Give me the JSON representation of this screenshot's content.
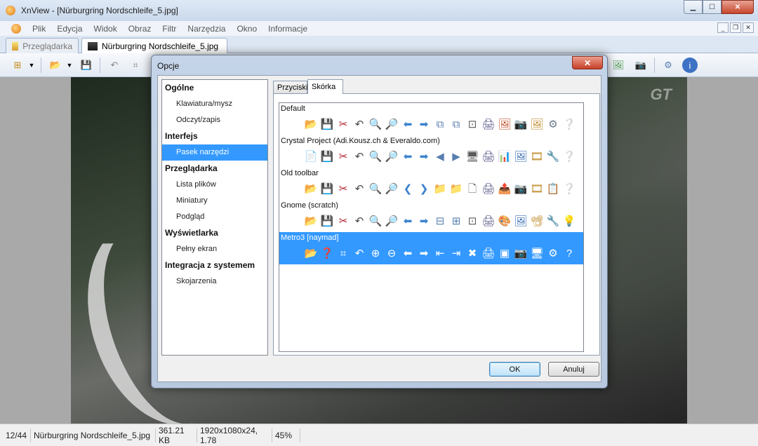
{
  "window": {
    "title": "XnView - [Nürburgring Nordschleife_5.jpg]"
  },
  "menu": [
    "Plik",
    "Edycja",
    "Widok",
    "Obraz",
    "Filtr",
    "Narzędzia",
    "Okno",
    "Informacje"
  ],
  "doc_tabs": [
    "Przeglądarka",
    "Nürburgring Nordschleife_5.jpg"
  ],
  "dialog": {
    "title": "Opcje",
    "close_label": "✕",
    "nav": [
      {
        "type": "head",
        "label": "Ogólne"
      },
      {
        "type": "item",
        "label": "Klawiatura/mysz"
      },
      {
        "type": "item",
        "label": "Odczyt/zapis"
      },
      {
        "type": "head",
        "label": "Interfejs"
      },
      {
        "type": "item",
        "label": "Pasek narzędzi",
        "selected": true
      },
      {
        "type": "head",
        "label": "Przeglądarka"
      },
      {
        "type": "item",
        "label": "Lista plików"
      },
      {
        "type": "item",
        "label": "Miniatury"
      },
      {
        "type": "item",
        "label": "Podgląd"
      },
      {
        "type": "head",
        "label": "Wyświetlarka"
      },
      {
        "type": "item",
        "label": "Pełny ekran"
      },
      {
        "type": "head",
        "label": "Integracja z systemem"
      },
      {
        "type": "item",
        "label": "Skojarzenia"
      }
    ],
    "tabs": {
      "buttons": "Przyciski",
      "skin": "Skórka"
    },
    "skins": [
      {
        "name": "Default",
        "icons": [
          "📂",
          "💾",
          "✂",
          "↶",
          "🔍",
          "🔎",
          "⬅",
          "➡",
          "⧉",
          "⧉",
          "⊡",
          "🖨",
          "🖼",
          "📷",
          "🖼",
          "⚙",
          "❔"
        ],
        "selected": false
      },
      {
        "name": "Crystal Project (Adi.Kousz.ch & Everaldo.com)",
        "icons": [
          "📄",
          "💾",
          "✂",
          "↶",
          "🔍",
          "🔎",
          "⬅",
          "➡",
          "◀",
          "▶",
          "🖥",
          "🖨",
          "📊",
          "🖼",
          "🎞",
          "🔧",
          "❔"
        ],
        "selected": false
      },
      {
        "name": "Old toolbar",
        "icons": [
          "📂",
          "💾",
          "✂",
          "↶",
          "🔍",
          "🔎",
          "❮",
          "❯",
          "📁",
          "📁",
          "🗋",
          "🖨",
          "📤",
          "📷",
          "🎞",
          "📋",
          "❔"
        ],
        "selected": false
      },
      {
        "name": "Gnome (scratch)",
        "icons": [
          "📂",
          "💾",
          "✂",
          "↶",
          "🔍",
          "🔎",
          "⬅",
          "➡",
          "⊟",
          "⊞",
          "⊡",
          "🖨",
          "🎨",
          "🖼",
          "📽",
          "🔧",
          "💡"
        ],
        "selected": false
      },
      {
        "name": "Metro3 [naymad]",
        "icons": [
          "📂",
          "❓",
          "⌗",
          "↶",
          "⊕",
          "⊖",
          "⬅",
          "➡",
          "⇤",
          "⇥",
          "✖",
          "🖨",
          "▣",
          "📷",
          "🖥",
          "⚙",
          "?"
        ],
        "selected": true
      }
    ],
    "ok_label": "OK",
    "cancel_label": "Anuluj"
  },
  "status": {
    "position": "12/44",
    "filename": "Nürburgring Nordschleife_5.jpg",
    "filesize": "361.21 KB",
    "dimensions": "1920x1080x24, 1.78",
    "zoom": "45%"
  },
  "photo": {
    "watermark": "GT"
  }
}
